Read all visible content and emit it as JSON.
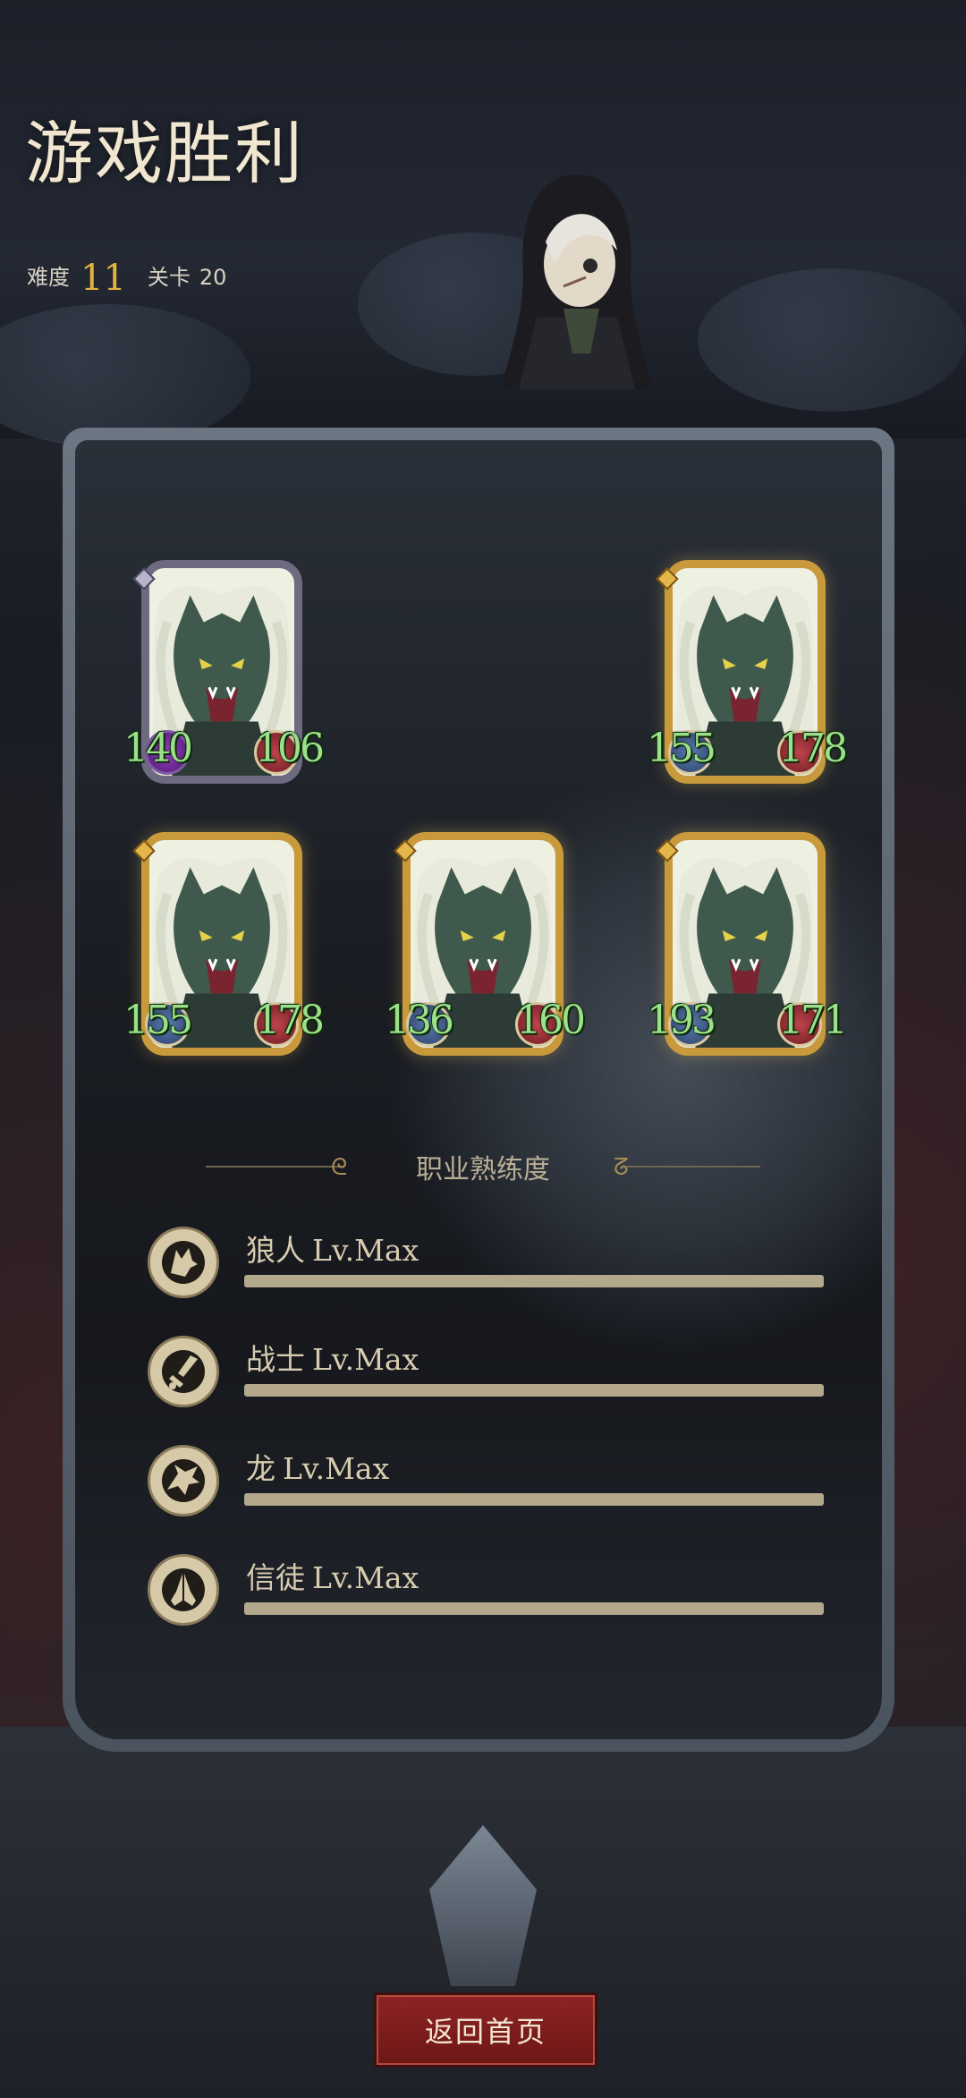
{
  "header": {
    "title": "游戏胜利",
    "difficulty_label": "难度",
    "difficulty_value": "11",
    "level_label": "关卡",
    "level_value": "20"
  },
  "cards": [
    {
      "rarity": "silver",
      "attack": "140",
      "health": "106"
    },
    {
      "rarity": "gold",
      "attack": "155",
      "health": "178"
    },
    {
      "rarity": "gold",
      "attack": "155",
      "health": "178"
    },
    {
      "rarity": "gold",
      "attack": "136",
      "health": "160"
    },
    {
      "rarity": "gold",
      "attack": "193",
      "health": "171"
    }
  ],
  "proficiency": {
    "title": "职业熟练度",
    "items": [
      {
        "name": "狼人",
        "level": "Lv.Max",
        "icon": "wolf-icon",
        "progress": 1.0
      },
      {
        "name": "战士",
        "level": "Lv.Max",
        "icon": "sword-icon",
        "progress": 1.0
      },
      {
        "name": "龙",
        "level": "Lv.Max",
        "icon": "dragon-icon",
        "progress": 1.0
      },
      {
        "name": "信徒",
        "level": "Lv.Max",
        "icon": "praying-hands-icon",
        "progress": 1.0
      }
    ]
  },
  "return_button_label": "返回首页",
  "colors": {
    "gold_frame": "#c99a3b",
    "silver_frame": "#6e6a80",
    "stat_green": "#9be08a",
    "button_red": "#8e2424"
  }
}
